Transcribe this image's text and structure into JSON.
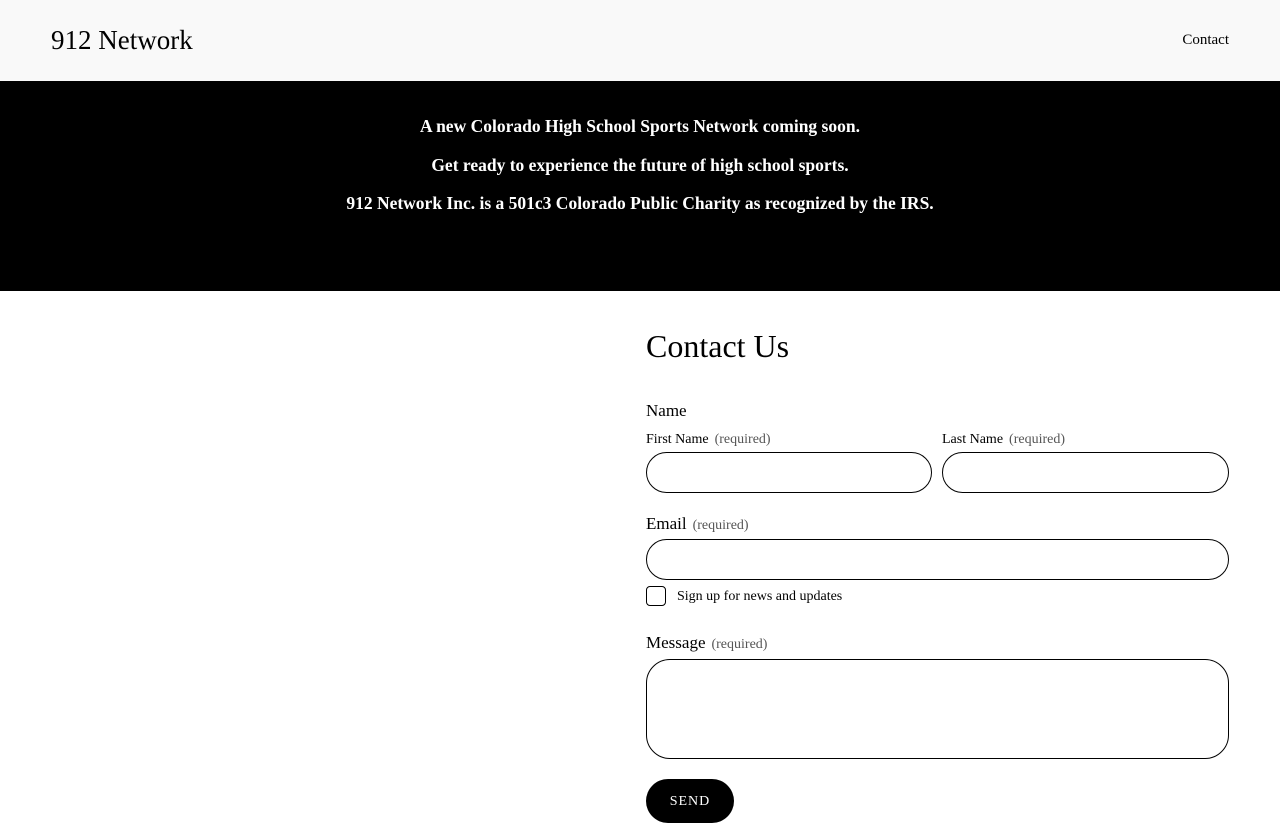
{
  "header": {
    "site_title": "912 Network",
    "nav": [
      {
        "label": "Contact"
      }
    ]
  },
  "banner": {
    "lines": [
      "A new Colorado High School Sports Network coming soon.",
      "Get ready to experience the future of high school sports.",
      "912 Network Inc. is a 501c3 Colorado Public Charity as recognized by the IRS."
    ]
  },
  "form": {
    "title": "Contact Us",
    "name_group_label": "Name",
    "first_name": {
      "label": "First Name",
      "required_text": "(required)",
      "value": ""
    },
    "last_name": {
      "label": "Last Name",
      "required_text": "(required)",
      "value": ""
    },
    "email": {
      "label": "Email",
      "required_text": "(required)",
      "value": ""
    },
    "newsletter": {
      "label": "Sign up for news and updates",
      "checked": false
    },
    "message": {
      "label": "Message",
      "required_text": "(required)",
      "value": ""
    },
    "submit_label": "SEND"
  },
  "colors": {
    "header_bg": "#f9f9f9",
    "banner_bg": "#000000",
    "banner_text": "#ffffff",
    "button_bg": "#000000",
    "button_text": "#ffffff"
  }
}
